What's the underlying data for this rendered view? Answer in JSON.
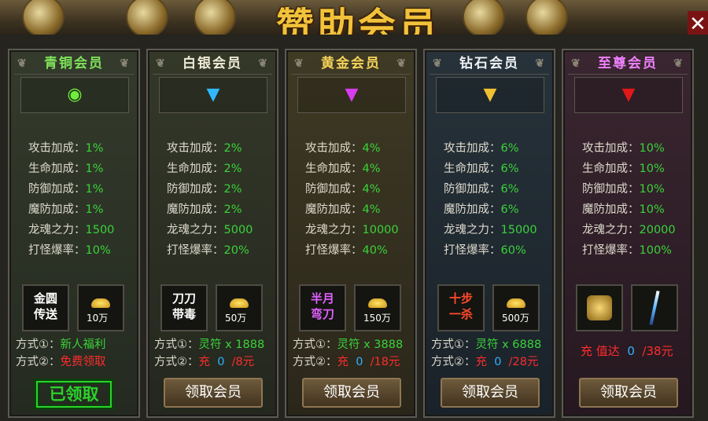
{
  "title": "赞助会员",
  "colors": {
    "green": "#3ad33a",
    "red": "#ff2c2c",
    "blue": "#2cb3ff"
  },
  "stat_labels": [
    "攻击加成：",
    "生命加成：",
    "防御加成：",
    "魔防加成：",
    "龙魂之力：",
    "打怪爆率："
  ],
  "tiers": [
    {
      "name": "青铜会员",
      "gem": "green-swirl-gem",
      "stats": [
        "1%",
        "1%",
        "1%",
        "1%",
        "1500",
        "10%"
      ],
      "item1": [
        "金圆",
        "传送"
      ],
      "item2": "10万",
      "way1_label": "方式①：",
      "way1_value": "新人福利",
      "way2_label": "方式②：",
      "way2_value": "免费领取",
      "status": "已领取"
    },
    {
      "name": "白银会员",
      "gem": "blue-v-gem",
      "stats": [
        "2%",
        "2%",
        "2%",
        "2%",
        "5000",
        "20%"
      ],
      "item1": [
        "刀刀",
        "带毒"
      ],
      "item2": "50万",
      "way1_label": "方式①：",
      "way1_value": "灵符 x 1888",
      "way2_label": "方式②：",
      "way2_charge": "充",
      "way2_progress": "0",
      "way2_price": "/8元",
      "button": "领取会员"
    },
    {
      "name": "黄金会员",
      "gem": "purple-v-gem",
      "stats": [
        "4%",
        "4%",
        "4%",
        "4%",
        "10000",
        "40%"
      ],
      "item1": [
        "半月",
        "弯刀"
      ],
      "item2": "150万",
      "way1_label": "方式①：",
      "way1_value": "灵符 x 3888",
      "way2_label": "方式②：",
      "way2_charge": "充",
      "way2_progress": "0",
      "way2_price": "/18元",
      "button": "领取会员"
    },
    {
      "name": "钻石会员",
      "gem": "gold-v-gem",
      "stats": [
        "6%",
        "6%",
        "6%",
        "6%",
        "15000",
        "60%"
      ],
      "item1": [
        "十步",
        "一杀"
      ],
      "item2": "500万",
      "way1_label": "方式①：",
      "way1_value": "灵符 x 6888",
      "way2_label": "方式②：",
      "way2_charge": "充",
      "way2_progress": "0",
      "way2_price": "/28元",
      "button": "领取会员"
    },
    {
      "name": "至尊会员",
      "gem": "red-v-gem",
      "stats": [
        "10%",
        "10%",
        "10%",
        "10%",
        "20000",
        "100%"
      ],
      "charge_label": "充 值达",
      "charge_progress": "0",
      "charge_price": "/38元",
      "button": "领取会员"
    }
  ]
}
